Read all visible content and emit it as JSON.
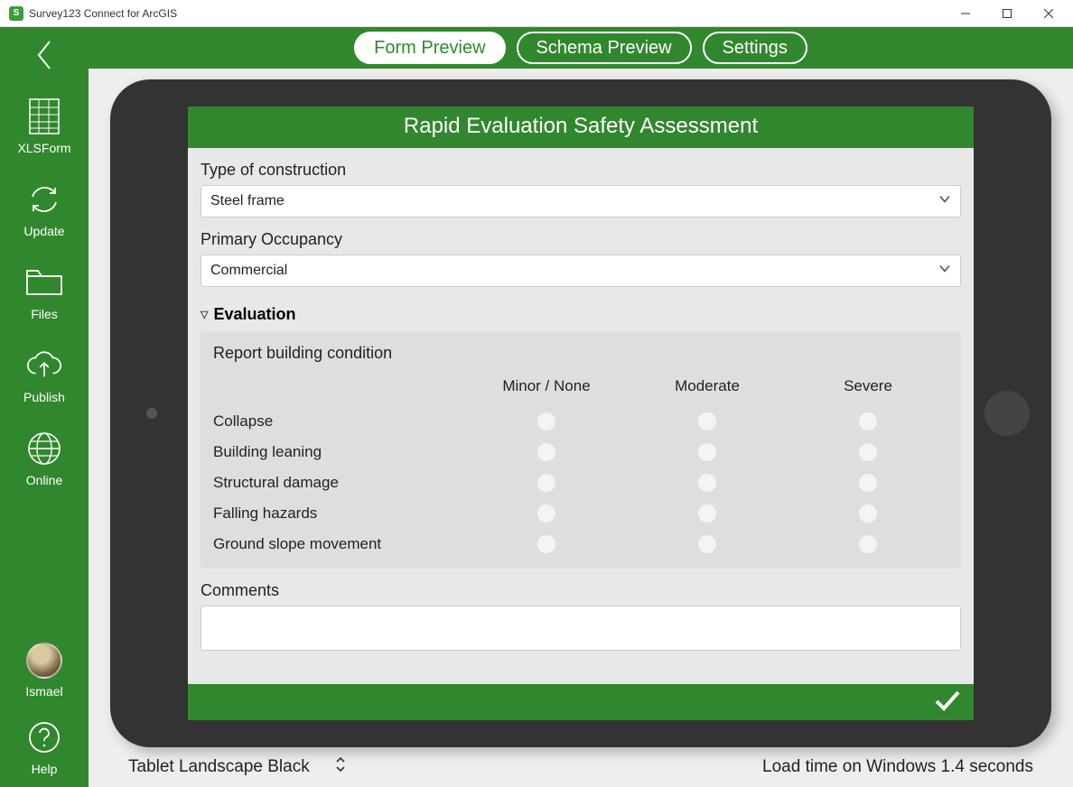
{
  "window": {
    "title": "Survey123 Connect for ArcGIS"
  },
  "sidebar": {
    "items": [
      {
        "label": "XLSForm"
      },
      {
        "label": "Update"
      },
      {
        "label": "Files"
      },
      {
        "label": "Publish"
      },
      {
        "label": "Online"
      }
    ],
    "user": {
      "name": "Ismael"
    },
    "help": {
      "label": "Help"
    }
  },
  "toolbar": {
    "form_preview": "Form Preview",
    "schema_preview": "Schema Preview",
    "settings": "Settings"
  },
  "form": {
    "title": "Rapid Evaluation Safety Assessment",
    "fields": {
      "type_construction": {
        "label": "Type of construction",
        "value": "Steel frame"
      },
      "primary_occupancy": {
        "label": "Primary Occupancy",
        "value": "Commercial"
      }
    },
    "evaluation": {
      "heading": "Evaluation",
      "subtitle": "Report building condition",
      "columns": [
        "Minor / None",
        "Moderate",
        "Severe"
      ],
      "rows": [
        "Collapse",
        "Building leaning",
        "Structural damage",
        "Falling hazards",
        "Ground slope movement"
      ]
    },
    "comments_label": "Comments"
  },
  "statusbar": {
    "device": "Tablet Landscape Black",
    "loadtime": "Load time on Windows 1.4 seconds"
  }
}
